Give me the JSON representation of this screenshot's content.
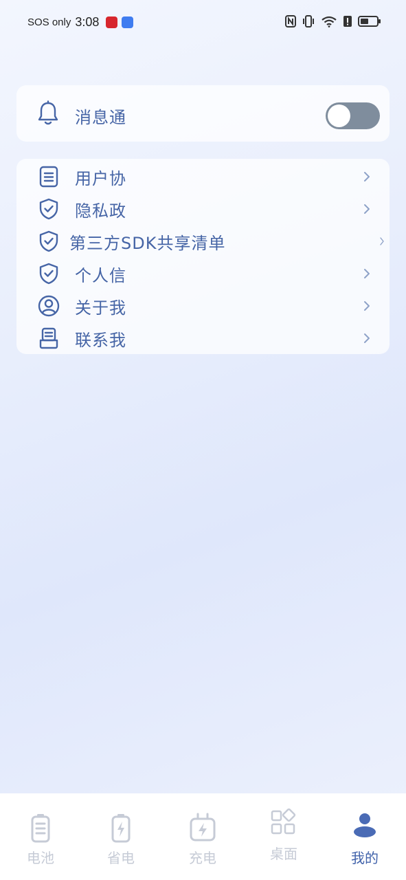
{
  "status_bar": {
    "carrier": "SOS only",
    "time": "3:08"
  },
  "message_card": {
    "label": "消息通",
    "icon": "bell-icon",
    "toggle_on": false
  },
  "menu": {
    "items": [
      {
        "label": "用户协",
        "icon": "document-icon"
      },
      {
        "label": "隐私政",
        "icon": "shield-check-icon"
      },
      {
        "label": "第三方SDK共享清单",
        "icon": "shield-check-icon"
      },
      {
        "label": "个人信",
        "icon": "shield-check-icon"
      },
      {
        "label": "关于我",
        "icon": "user-circle-icon"
      },
      {
        "label": "联系我",
        "icon": "contact-card-icon"
      }
    ]
  },
  "bottom_nav": {
    "items": [
      {
        "label": "电池",
        "icon": "battery-icon",
        "active": false
      },
      {
        "label": "省电",
        "icon": "battery-saver-icon",
        "active": false
      },
      {
        "label": "充电",
        "icon": "charging-icon",
        "active": false
      },
      {
        "label": "桌面",
        "icon": "widgets-icon",
        "active": false
      },
      {
        "label": "我的",
        "icon": "user-icon",
        "active": true
      }
    ]
  },
  "colors": {
    "accent": "#4665a6",
    "toggle_off": "#7f8d9d",
    "nav_inactive": "#c6cbd6",
    "nav_active": "#4062aa"
  }
}
